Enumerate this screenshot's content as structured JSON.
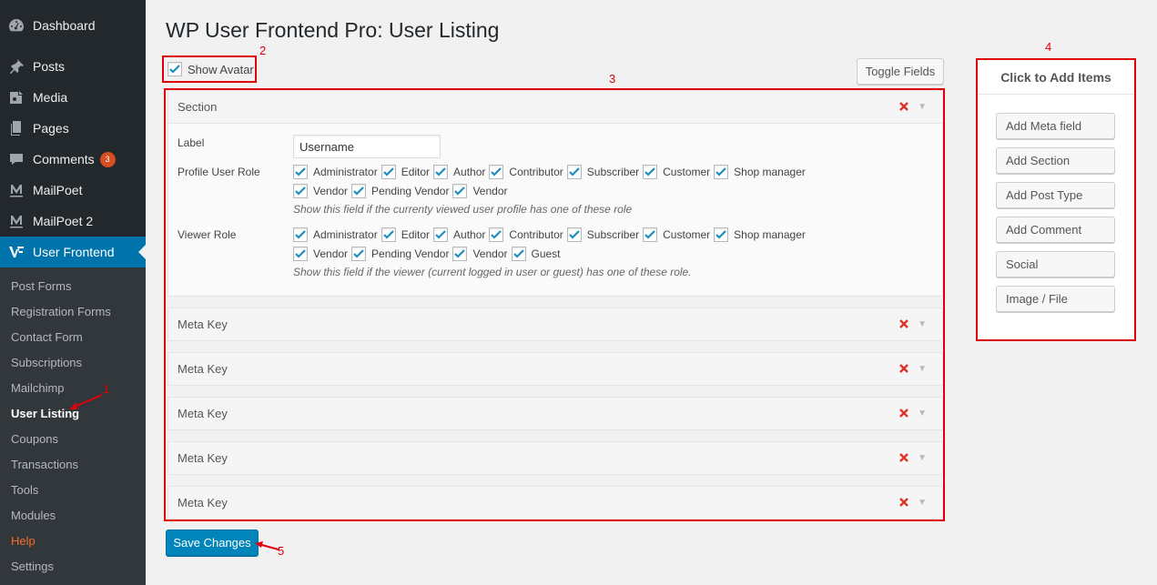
{
  "sidebar": {
    "top_items": [
      {
        "label": "Dashboard",
        "icon": "dashboard-icon"
      },
      {
        "label": "Posts",
        "icon": "pin-icon"
      },
      {
        "label": "Media",
        "icon": "media-icon"
      },
      {
        "label": "Pages",
        "icon": "pages-icon"
      },
      {
        "label": "Comments",
        "icon": "comment-icon",
        "badge": "3"
      },
      {
        "label": "MailPoet",
        "icon": "mailpoet-icon"
      },
      {
        "label": "MailPoet 2",
        "icon": "mailpoet-icon"
      },
      {
        "label": "User Frontend",
        "icon": "user-frontend-icon"
      }
    ],
    "sub_items": [
      "Post Forms",
      "Registration Forms",
      "Contact Form",
      "Subscriptions",
      "Mailchimp",
      "User Listing",
      "Coupons",
      "Transactions",
      "Tools",
      "Modules",
      "Help",
      "Settings"
    ]
  },
  "page": {
    "title": "WP User Frontend Pro: User Listing",
    "show_avatar_label": "Show Avatar",
    "toggle_fields_label": "Toggle Fields",
    "save_label": "Save Changes"
  },
  "annotations": [
    "1",
    "2",
    "3",
    "4",
    "5"
  ],
  "section": {
    "header": "Section",
    "label_title": "Label",
    "label_value": "Username",
    "profile_role_title": "Profile User Role",
    "profile_roles_row1": [
      "Administrator",
      "Editor",
      "Author",
      "Contributor",
      "Subscriber",
      "Customer",
      "Shop manager"
    ],
    "profile_roles_row2": [
      "Vendor",
      "Pending Vendor",
      "Vendor"
    ],
    "profile_hint": "Show this field if the currenty viewed user profile has one of these role",
    "viewer_role_title": "Viewer Role",
    "viewer_roles_row1": [
      "Administrator",
      "Editor",
      "Author",
      "Contributor",
      "Subscriber",
      "Customer",
      "Shop manager"
    ],
    "viewer_roles_row2": [
      "Vendor",
      "Pending Vendor",
      "Vendor",
      "Guest"
    ],
    "viewer_hint": "Show this field if the viewer (current logged in user or guest) has one of these role."
  },
  "meta_rows": [
    "Meta Key",
    "Meta Key",
    "Meta Key",
    "Meta Key",
    "Meta Key"
  ],
  "add_items": {
    "title": "Click to Add Items",
    "buttons": [
      "Add Meta field",
      "Add Section",
      "Add Post Type",
      "Add Comment",
      "Social",
      "Image / File"
    ]
  },
  "colors": {
    "accent": "#0073aa",
    "annotation": "#e0000a",
    "sidebar": "#23282d"
  }
}
